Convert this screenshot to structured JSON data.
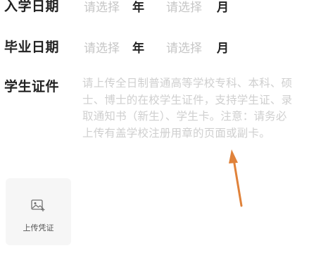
{
  "form": {
    "enrollment": {
      "label": "入学日期",
      "year_placeholder": "请选择",
      "year_unit": "年",
      "month_placeholder": "请选择",
      "month_unit": "月"
    },
    "graduation": {
      "label": "毕业日期",
      "year_placeholder": "请选择",
      "year_unit": "年",
      "month_placeholder": "请选择",
      "month_unit": "月"
    },
    "student_certificate": {
      "label": "学生证件",
      "hint": "请上传全日制普通高等学校专科、本科、硕士、博士的在校学生证件，支持学生证、录取通知书（新生）、学生卡。注意：请务必上传有盖学校注册用章的页面或副卡。"
    },
    "upload": {
      "label": "上传凭证",
      "icon": "image-add-icon"
    }
  },
  "annotation": {
    "icon": "arrow-up-icon",
    "color": "#e0823a"
  }
}
